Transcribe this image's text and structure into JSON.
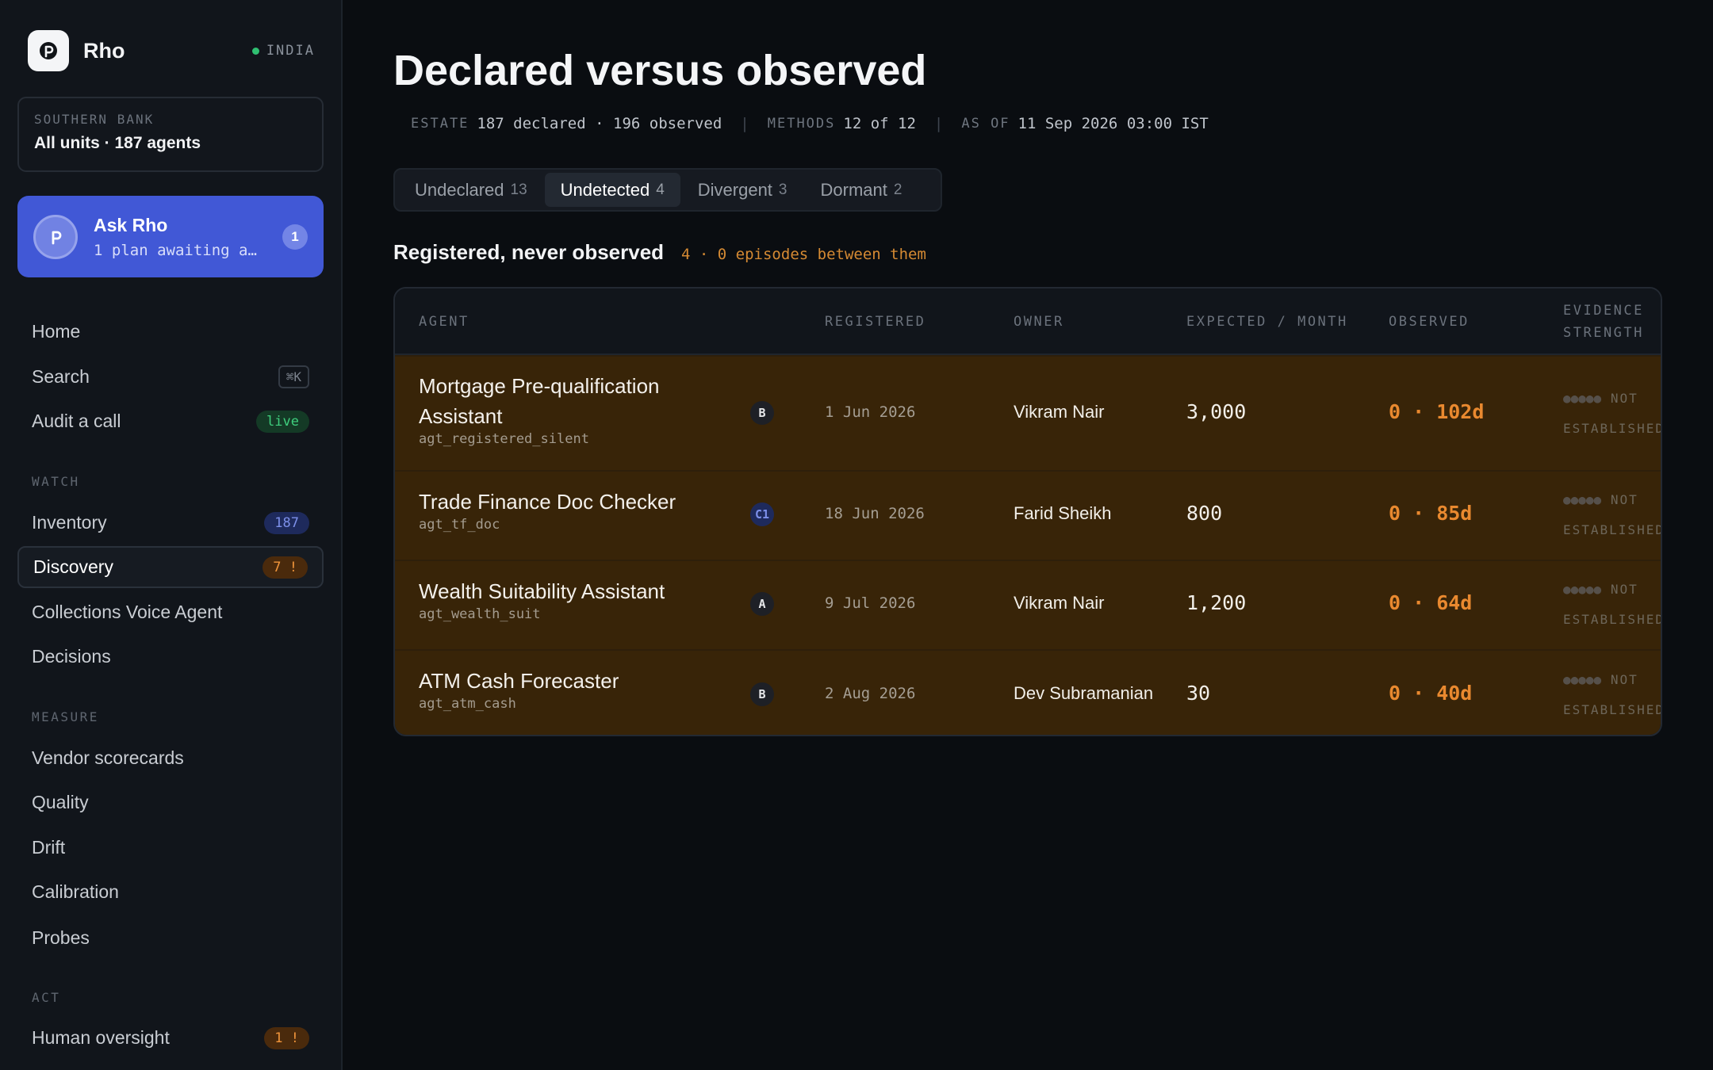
{
  "brand": {
    "name": "Rho",
    "region": "INDIA"
  },
  "scope": {
    "label": "SOUTHERN BANK",
    "value": "All units · 187 agents"
  },
  "ask": {
    "title": "Ask Rho",
    "subtitle": "1 plan awaiting a…",
    "badge": "1"
  },
  "nav": {
    "home": "Home",
    "search": "Search",
    "search_shortcut": "⌘K",
    "audit": "Audit a call",
    "audit_badge": "live",
    "watch_label": "WATCH",
    "inventory": "Inventory",
    "inventory_count": "187",
    "discovery": "Discovery",
    "discovery_badge": "7 !",
    "collections": "Collections Voice Agent",
    "decisions": "Decisions",
    "measure_label": "MEASURE",
    "vendor": "Vendor scorecards",
    "quality": "Quality",
    "drift": "Drift",
    "calibration": "Calibration",
    "probes": "Probes",
    "act_label": "ACT",
    "oversight": "Human oversight",
    "oversight_badge": "1 !"
  },
  "page": {
    "title": "Declared versus observed",
    "meta": {
      "estate_label": "ESTATE",
      "estate_value": "187 declared · 196 observed",
      "methods_label": "METHODS",
      "methods_value": "12 of 12",
      "asof_label": "AS OF",
      "asof_value": "11 Sep 2026 03:00 IST"
    }
  },
  "tabs": [
    {
      "label": "Undeclared",
      "count": "13"
    },
    {
      "label": "Undetected",
      "count": "4"
    },
    {
      "label": "Divergent",
      "count": "3"
    },
    {
      "label": "Dormant",
      "count": "2"
    }
  ],
  "section": {
    "title": "Registered, never observed",
    "note": "4 · 0 episodes between them"
  },
  "table": {
    "headers": {
      "agent": "AGENT",
      "registered": "REGISTERED",
      "owner": "OWNER",
      "expected": "EXPECTED / MONTH",
      "observed": "OBSERVED",
      "evidence_1": "EVIDENCE",
      "evidence_2": "STRENGTH"
    },
    "rows": [
      {
        "name": "Mortgage Pre-qualification Assistant",
        "id": "agt_registered_silent",
        "tier": "B",
        "registered": "1 Jun 2026",
        "owner": "Vikram Nair",
        "expected": "3,000",
        "observed": "0 · 102d",
        "evidence_1": "NOT",
        "evidence_2": "ESTABLISHED"
      },
      {
        "name": "Trade Finance Doc Checker",
        "id": "agt_tf_doc",
        "tier": "C1",
        "registered": "18 Jun 2026",
        "owner": "Farid Sheikh",
        "expected": "800",
        "observed": "0 · 85d",
        "evidence_1": "NOT",
        "evidence_2": "ESTABLISHED"
      },
      {
        "name": "Wealth Suitability Assistant",
        "id": "agt_wealth_suit",
        "tier": "A",
        "registered": "9 Jul 2026",
        "owner": "Vikram Nair",
        "expected": "1,200",
        "observed": "0 · 64d",
        "evidence_1": "NOT",
        "evidence_2": "ESTABLISHED"
      },
      {
        "name": "ATM Cash Forecaster",
        "id": "agt_atm_cash",
        "tier": "B",
        "registered": "2 Aug 2026",
        "owner": "Dev Subramanian",
        "expected": "30",
        "observed": "0 · 40d",
        "evidence_1": "NOT",
        "evidence_2": "ESTABLISHED"
      }
    ]
  },
  "colors": {
    "accent": "#4158d6",
    "row_bg": "#382408",
    "observed": "#e9892f",
    "live": "#3fcf7e"
  }
}
